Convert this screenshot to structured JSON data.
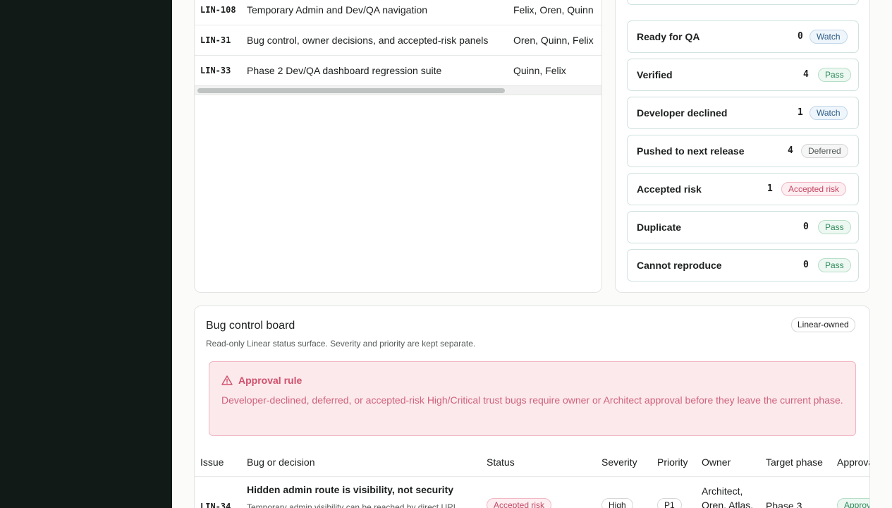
{
  "issues": [
    {
      "id": "LIN-108",
      "title": "Temporary Admin and Dev/QA navigation",
      "owners": "Felix, Oren, Quinn"
    },
    {
      "id": "LIN-31",
      "title": "Bug control, owner decisions, and accepted-risk panels",
      "owners": "Oren, Quinn, Felix"
    },
    {
      "id": "LIN-33",
      "title": "Phase 2 Dev/QA dashboard regression suite",
      "owners": "Quinn, Felix"
    }
  ],
  "statuses": [
    {
      "label": "Ready for QA",
      "count": "0",
      "badge": "Watch",
      "kind": "watch"
    },
    {
      "label": "Verified",
      "count": "4",
      "badge": "Pass",
      "kind": "pass"
    },
    {
      "label": "Developer declined",
      "count": "1",
      "badge": "Watch",
      "kind": "watch"
    },
    {
      "label": "Pushed to next release",
      "count": "4",
      "badge": "Deferred",
      "kind": "deferred"
    },
    {
      "label": "Accepted risk",
      "count": "1",
      "badge": "Accepted risk",
      "kind": "risk"
    },
    {
      "label": "Duplicate",
      "count": "0",
      "badge": "Pass",
      "kind": "pass"
    },
    {
      "label": "Cannot reproduce",
      "count": "0",
      "badge": "Pass",
      "kind": "pass"
    }
  ],
  "bug_board": {
    "title": "Bug control board",
    "subtitle": "Read-only Linear status surface. Severity and priority are kept separate.",
    "owned_badge": "Linear-owned",
    "alert_title": "Approval rule",
    "alert_text": "Developer-declined, deferred, or accepted-risk High/Critical trust bugs require owner or Architect approval before they leave the current phase.",
    "columns": {
      "issue": "Issue",
      "bug": "Bug or decision",
      "status": "Status",
      "severity": "Severity",
      "priority": "Priority",
      "owner": "Owner",
      "target": "Target phase",
      "approval": "Approval"
    },
    "rows": [
      {
        "id": "LIN-34",
        "title": "Hidden admin route is visibility, not security",
        "desc": "Temporary admin visibility can be reached by direct URL",
        "status": "Accepted risk",
        "severity": "High",
        "priority": "P1",
        "owner_line1": "Architect,",
        "owner_line2": "Oren, Atlas,",
        "target": "Phase 3",
        "approval": "Approved"
      }
    ]
  },
  "colors": {
    "sidebar": "#121a17",
    "pass": "#2e8c5a",
    "watch": "#2d5c85",
    "risk": "#c64763",
    "alert_bg": "#fbe9ec"
  }
}
